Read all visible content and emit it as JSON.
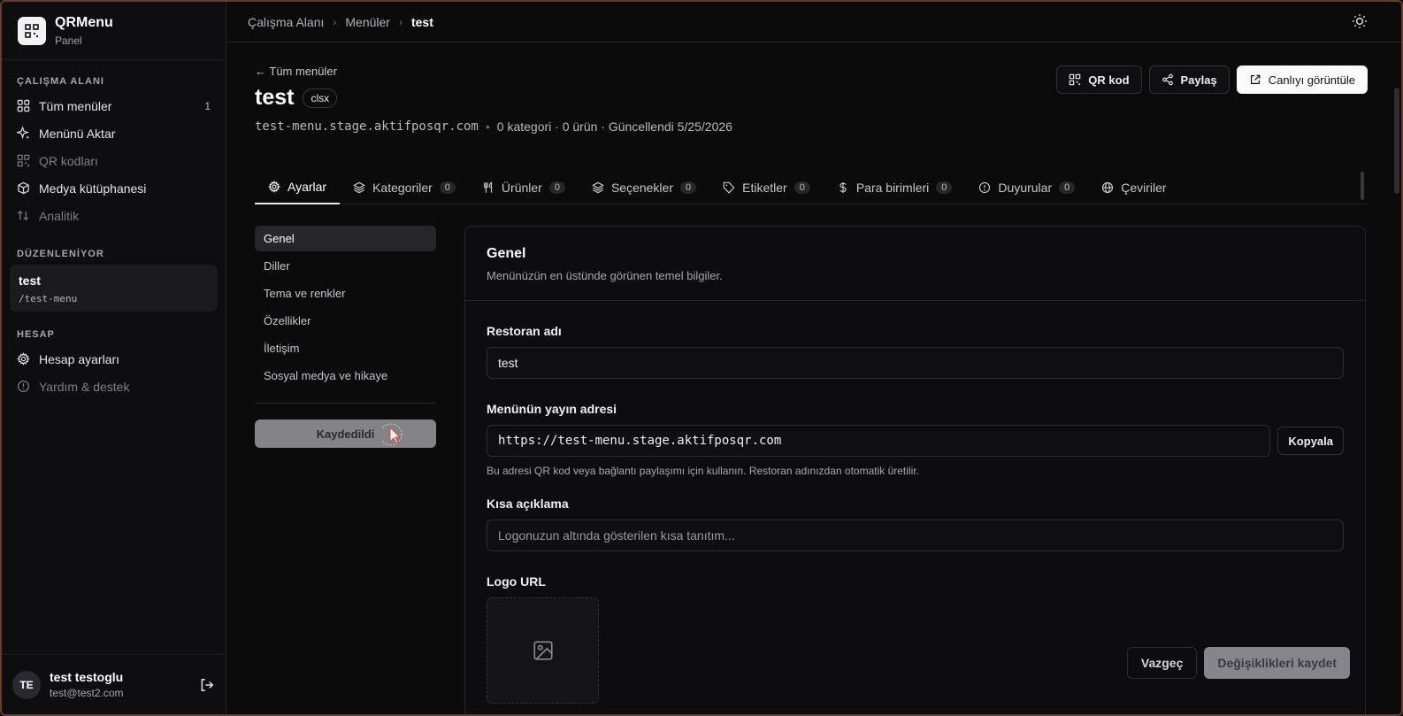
{
  "brand": {
    "title": "QRMenu",
    "subtitle": "Panel"
  },
  "sidebar": {
    "workspace_label": "ÇALIŞMA ALANI",
    "workspace_items": [
      {
        "label": "Tüm menüler",
        "icon": "grid-icon",
        "count": "1"
      },
      {
        "label": "Menünü Aktar",
        "icon": "sparkle-icon"
      },
      {
        "label": "QR kodları",
        "icon": "qr-icon"
      },
      {
        "label": "Medya kütüphanesi",
        "icon": "cube-icon"
      },
      {
        "label": "Analitik",
        "icon": "sort-arrows-icon"
      }
    ],
    "editing_label": "DÜZENLENİYOR",
    "editing": {
      "title": "test",
      "path": "/test-menu"
    },
    "account_label": "HESAP",
    "account_items": [
      {
        "label": "Hesap ayarları",
        "icon": "gear-icon"
      },
      {
        "label": "Yardım & destek",
        "icon": "help-circle-icon"
      }
    ],
    "user": {
      "initials": "TE",
      "name": "test testoglu",
      "email": "test@test2.com"
    }
  },
  "breadcrumb": {
    "items": [
      "Çalışma Alanı",
      "Menüler",
      "test"
    ]
  },
  "header": {
    "back_label": "← Tüm menüler",
    "title": "test",
    "badge": "clsx",
    "slug": "test-menu.stage.aktifposqr.com",
    "meta": "0 kategori · 0 ürün · Güncellendi 5/25/2026",
    "actions": {
      "qr": "QR kod",
      "share": "Paylaş",
      "live": "Canlıyı görüntüle"
    }
  },
  "tabs": [
    {
      "label": "Ayarlar",
      "icon": "gear-icon",
      "active": true
    },
    {
      "label": "Kategoriler",
      "icon": "layers-icon",
      "count": "0"
    },
    {
      "label": "Ürünler",
      "icon": "utensils-icon",
      "count": "0"
    },
    {
      "label": "Seçenekler",
      "icon": "layers-icon",
      "count": "0"
    },
    {
      "label": "Etiketler",
      "icon": "tag-icon",
      "count": "0"
    },
    {
      "label": "Para birimleri",
      "icon": "dollar-icon",
      "count": "0"
    },
    {
      "label": "Duyurular",
      "icon": "alert-circle-icon",
      "count": "0"
    },
    {
      "label": "Çeviriler",
      "icon": "globe-icon"
    }
  ],
  "settings_nav": {
    "items": [
      "Genel",
      "Diller",
      "Tema ve renkler",
      "Özellikler",
      "İletişim",
      "Sosyal medya ve hikaye"
    ],
    "saved_label": "Kaydedildi"
  },
  "panel": {
    "title": "Genel",
    "description": "Menünüzün en üstünde görünen temel bilgiler.",
    "name_label": "Restoran adı",
    "name_value": "test",
    "url_label": "Menünün yayın adresi",
    "url_value": "https://test-menu.stage.aktifposqr.com",
    "copy_label": "Kopyala",
    "url_hint": "Bu adresi QR kod veya bağlantı paylaşımı için kullanın. Restoran adınızdan otomatik üretilir.",
    "short_label": "Kısa açıklama",
    "short_placeholder": "Logonuzun altında gösterilen kısa tanıtım...",
    "logo_label": "Logo URL"
  },
  "footer": {
    "cancel": "Vazgeç",
    "save": "Değişiklikleri kaydet"
  }
}
